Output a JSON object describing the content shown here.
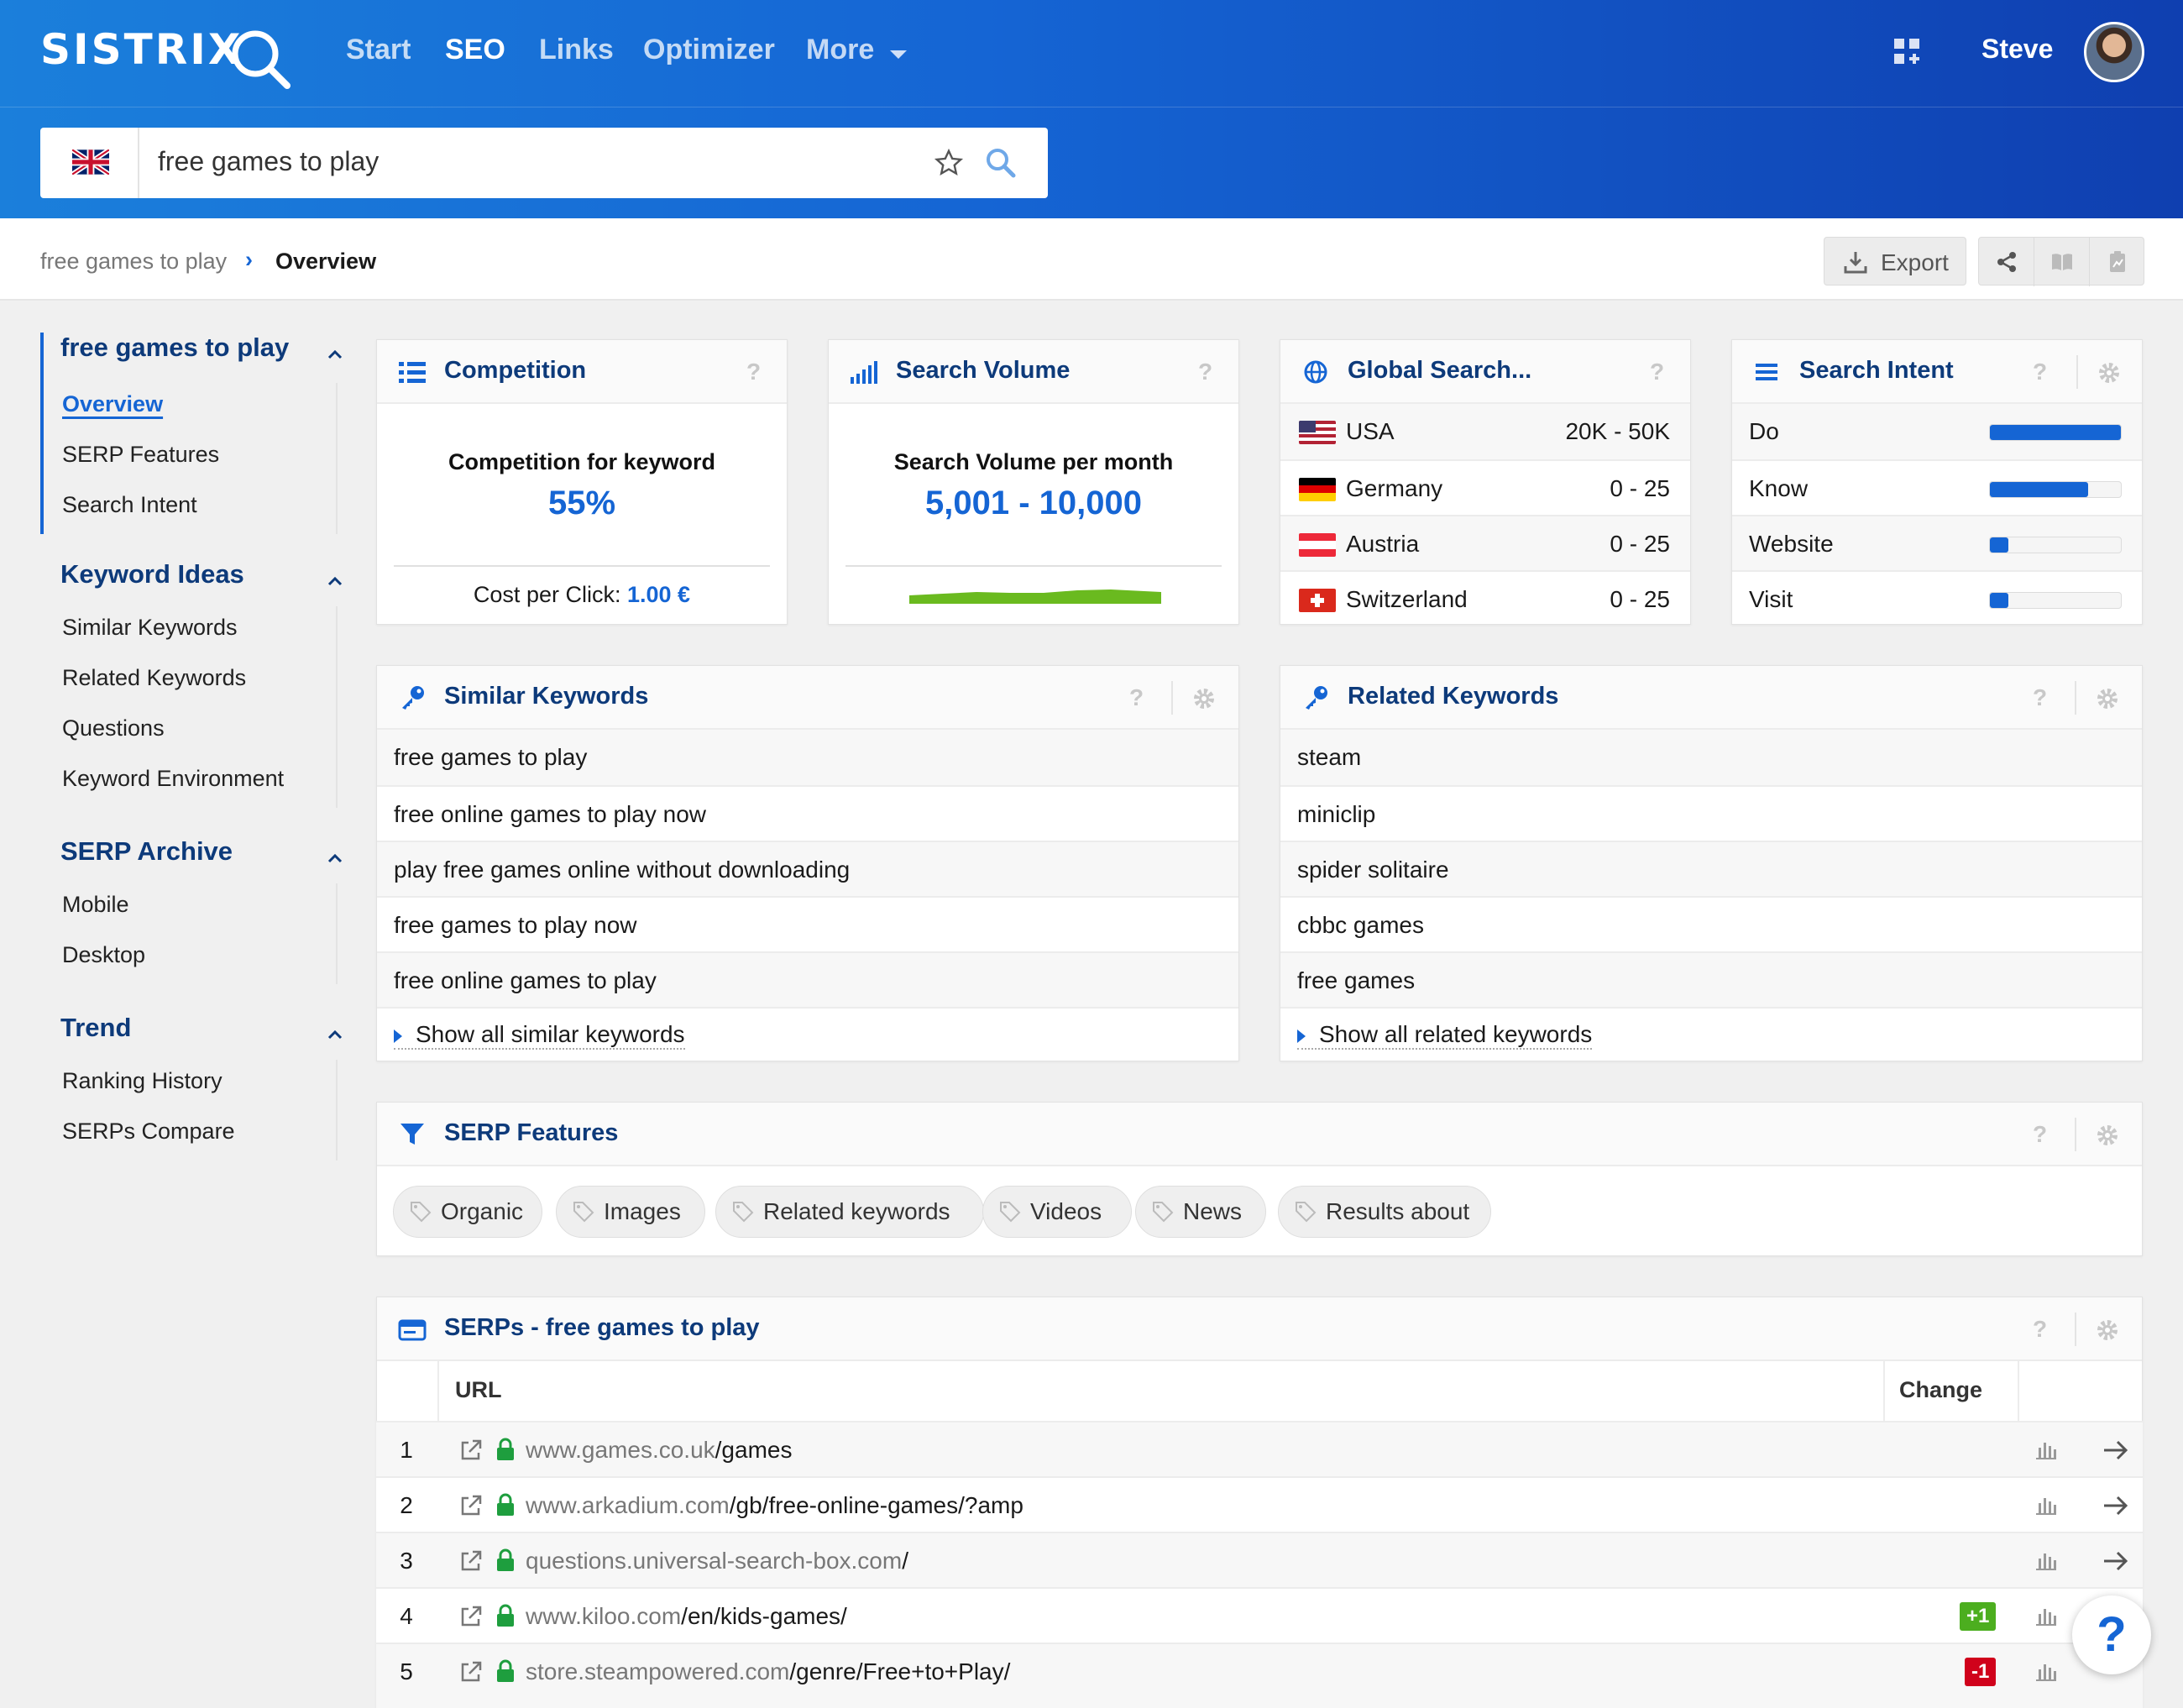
{
  "app": {
    "logo": "SISTRIX",
    "nav": [
      "Start",
      "SEO",
      "Links",
      "Optimizer",
      "More"
    ],
    "active_nav": "SEO",
    "user": "Steve"
  },
  "search": {
    "query": "free games to play",
    "country": "uk-flag-icon"
  },
  "breadcrumb": {
    "parent": "free games to play",
    "current": "Overview"
  },
  "toolbar": {
    "export_label": "Export"
  },
  "sidebar": {
    "group1": {
      "title": "free games to play",
      "items": [
        "Overview",
        "SERP Features",
        "Search Intent"
      ]
    },
    "group2": {
      "title": "Keyword Ideas",
      "items": [
        "Similar Keywords",
        "Related Keywords",
        "Questions",
        "Keyword Environment"
      ]
    },
    "group3": {
      "title": "SERP Archive",
      "items": [
        "Mobile",
        "Desktop"
      ]
    },
    "group4": {
      "title": "Trend",
      "items": [
        "Ranking History",
        "SERPs Compare"
      ]
    }
  },
  "competition": {
    "title": "Competition",
    "label": "Competition for keyword",
    "value": "55%",
    "cpc_label": "Cost per Click:",
    "cpc_value": "1.00 €"
  },
  "volume": {
    "title": "Search Volume",
    "label": "Search Volume per month",
    "value": "5,001 - 10,000"
  },
  "global": {
    "title": "Global Search...",
    "rows": [
      {
        "country": "USA",
        "value": "20K - 50K"
      },
      {
        "country": "Germany",
        "value": "0 - 25"
      },
      {
        "country": "Austria",
        "value": "0 - 25"
      },
      {
        "country": "Switzerland",
        "value": "0 - 25"
      }
    ]
  },
  "intent": {
    "title": "Search Intent",
    "rows": [
      {
        "label": "Do",
        "level": 1.0
      },
      {
        "label": "Know",
        "level": 0.75
      },
      {
        "label": "Website",
        "level": 0.14
      },
      {
        "label": "Visit",
        "level": 0.14
      }
    ]
  },
  "similar": {
    "title": "Similar Keywords",
    "items": [
      "free games to play",
      "free online games to play now",
      "play free games online without downloading",
      "free games to play now",
      "free online games to play"
    ],
    "show_all": "Show all similar keywords"
  },
  "related": {
    "title": "Related Keywords",
    "items": [
      "steam",
      "miniclip",
      "spider solitaire",
      "cbbc games",
      "free games"
    ],
    "show_all": "Show all related keywords"
  },
  "serp_features": {
    "title": "SERP Features",
    "tags": [
      "Organic",
      "Images",
      "Related keywords",
      "Videos",
      "News",
      "Results about"
    ]
  },
  "serps": {
    "title": "SERPs - free games to play",
    "col_url": "URL",
    "col_change": "Change",
    "rows": [
      {
        "pos": "1",
        "domain": "www.games.co.uk",
        "path": "/games",
        "change": ""
      },
      {
        "pos": "2",
        "domain": "www.arkadium.com",
        "path": "/gb/free-online-games/?amp",
        "change": ""
      },
      {
        "pos": "3",
        "domain": "questions.universal-search-box.com",
        "path": "/",
        "change": ""
      },
      {
        "pos": "4",
        "domain": "www.kiloo.com",
        "path": "/en/kids-games/",
        "change": "+1"
      },
      {
        "pos": "5",
        "domain": "store.steampowered.com",
        "path": "/genre/Free+to+Play/",
        "change": "-1"
      }
    ]
  },
  "colors": {
    "accent": "#1565d4",
    "positive": "#4cae1f",
    "negative": "#d0021b",
    "sparkline": "#6aba1f"
  }
}
